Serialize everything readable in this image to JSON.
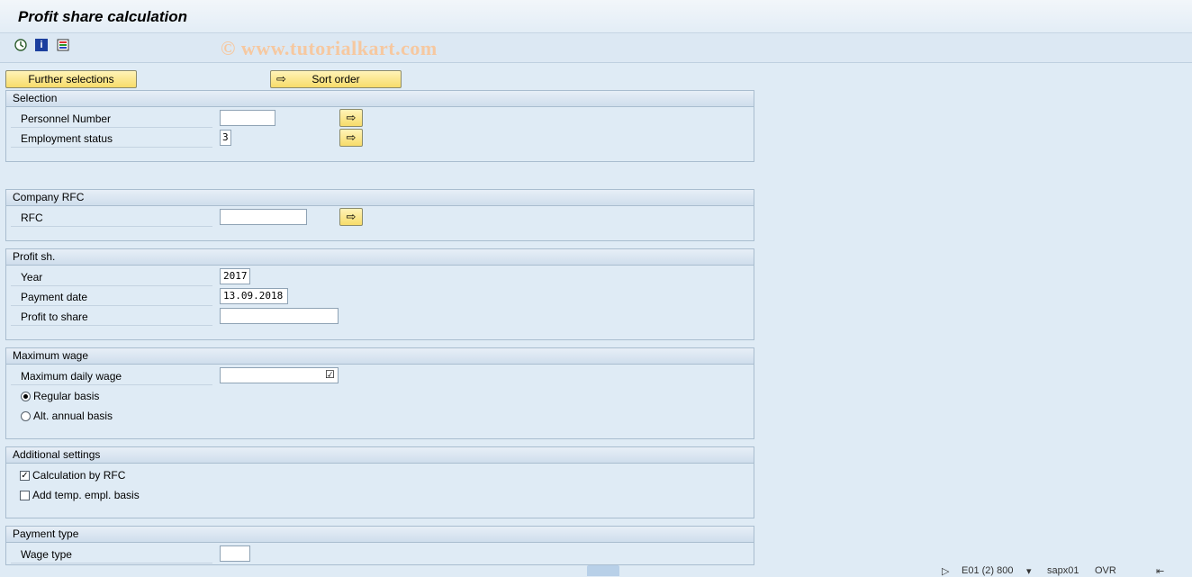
{
  "window": {
    "title": "Profit share calculation"
  },
  "toolbar": {
    "icons": [
      "execute-icon",
      "info-icon",
      "selection-options-icon"
    ],
    "watermark": "© www.tutorialkart.com"
  },
  "buttons": {
    "further_selections": "Further selections",
    "sort_order": "Sort order"
  },
  "selection": {
    "header": "Selection",
    "personnel_number": {
      "label": "Personnel Number",
      "value": ""
    },
    "employment_status": {
      "label": "Employment status",
      "value": "3"
    }
  },
  "company_rfc": {
    "header": "Company RFC",
    "rfc": {
      "label": "RFC",
      "value": ""
    }
  },
  "profit_share": {
    "header": "Profit sh.",
    "year": {
      "label": "Year",
      "value": "2017"
    },
    "payment_date": {
      "label": "Payment date",
      "value": "13.09.2018"
    },
    "profit_to_share": {
      "label": "Profit to share",
      "value": ""
    }
  },
  "maximum_wage": {
    "header": "Maximum wage",
    "max_daily_wage": {
      "label": "Maximum daily wage",
      "value": ""
    },
    "regular_basis": {
      "label": "Regular basis",
      "selected": true
    },
    "alt_annual_basis": {
      "label": "Alt. annual basis",
      "selected": false
    }
  },
  "additional_settings": {
    "header": "Additional settings",
    "calc_by_rfc": {
      "label": "Calculation by RFC",
      "checked": true
    },
    "add_temp_empl_basis": {
      "label": "Add temp. empl. basis",
      "checked": false
    }
  },
  "payment_type": {
    "header": "Payment type",
    "wage_type": {
      "label": "Wage type",
      "value": ""
    }
  },
  "status": {
    "system": "E01 (2) 800",
    "server": "sapx01",
    "mode": "OVR"
  },
  "colors": {
    "background": "#dfebf5",
    "button_yellow": "#f7dc6a",
    "group_border": "#a9bdcf"
  }
}
